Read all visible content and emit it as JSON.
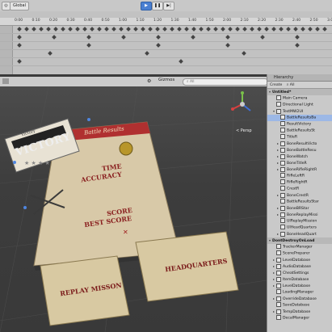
{
  "toolbar": {
    "pivot_label": "Global",
    "play_icon": "play-icon",
    "pause_icon": "pause-icon",
    "step_icon": "step-icon"
  },
  "timeline": {
    "ticks": [
      "0:00",
      "0:10",
      "0:20",
      "0:30",
      "0:40",
      "0:50",
      "1:00",
      "1:10",
      "1:20",
      "1:30",
      "1:40",
      "1:50",
      "2:00",
      "2:10",
      "2:20",
      "2:30",
      "2:40",
      "2:50",
      "3:00"
    ]
  },
  "scene_view": {
    "gizmos_label": "Gizmos",
    "search_placeholder": "All",
    "persp_label": "< Persp"
  },
  "game_ui": {
    "victory_banner_top": "Victory",
    "victory_banner": "VICTORY",
    "panel_header": "Battle Results",
    "time_label": "TIME",
    "accuracy_label": "ACCURACY",
    "score_label": "SCORE",
    "best_score_label": "BEST SCORE",
    "replay_button": "REPLAY MISSON",
    "hq_button": "HEADQUARTERS"
  },
  "hierarchy": {
    "tab_label": "Hierarchy",
    "create_label": "Create",
    "search_placeholder": "All",
    "scene_name": "Untitled*",
    "items": [
      {
        "label": "Main Camera",
        "indent": 1,
        "arrow": ""
      },
      {
        "label": "Directional Light",
        "indent": 1,
        "arrow": ""
      },
      {
        "label": "TestMW2UI",
        "indent": 1,
        "arrow": "▾"
      },
      {
        "label": "BattleResultsBa",
        "indent": 2,
        "arrow": "",
        "selected": true
      },
      {
        "label": "ResultVictory",
        "indent": 2,
        "arrow": ""
      },
      {
        "label": "BattleResultsSt",
        "indent": 2,
        "arrow": ""
      },
      {
        "label": "TitleR",
        "indent": 2,
        "arrow": ""
      },
      {
        "label": "BoneResultVicto",
        "indent": 2,
        "arrow": "▸"
      },
      {
        "label": "BoneBattleResu",
        "indent": 2,
        "arrow": "▸"
      },
      {
        "label": "BoneWatch",
        "indent": 2,
        "arrow": "▸"
      },
      {
        "label": "BoneTitleR",
        "indent": 2,
        "arrow": "▸"
      },
      {
        "label": "BoneRifleRightR",
        "indent": 2,
        "arrow": "▸"
      },
      {
        "label": "RifleLeftR",
        "indent": 2,
        "arrow": ""
      },
      {
        "label": "RifleRightR",
        "indent": 2,
        "arrow": ""
      },
      {
        "label": "CrestR",
        "indent": 2,
        "arrow": ""
      },
      {
        "label": "BoneCrestR",
        "indent": 2,
        "arrow": "▸"
      },
      {
        "label": "BattleResultsStar",
        "indent": 2,
        "arrow": ""
      },
      {
        "label": "BoneBRStar",
        "indent": 2,
        "arrow": "▸"
      },
      {
        "label": "BoneReplayMissi",
        "indent": 2,
        "arrow": "▸"
      },
      {
        "label": "UIReplayMission",
        "indent": 2,
        "arrow": ""
      },
      {
        "label": "UIHeadQuarters",
        "indent": 2,
        "arrow": ""
      },
      {
        "label": "BoneHeadQuart",
        "indent": 2,
        "arrow": "▸"
      }
    ],
    "scene2_name": "DontDestroyOnLoad",
    "items2": [
      {
        "label": "TrackerManager",
        "indent": 1,
        "arrow": ""
      },
      {
        "label": "ScenePreparer",
        "indent": 1,
        "arrow": ""
      },
      {
        "label": "LevelDatabase",
        "indent": 1,
        "arrow": "▸"
      },
      {
        "label": "AudioDatabase",
        "indent": 1,
        "arrow": "▸"
      },
      {
        "label": "CheatSettings",
        "indent": 1,
        "arrow": "▸"
      },
      {
        "label": "ItemDatabase",
        "indent": 1,
        "arrow": "▸"
      },
      {
        "label": "LevelDatabase",
        "indent": 1,
        "arrow": "▸"
      },
      {
        "label": "LoadingManager",
        "indent": 1,
        "arrow": ""
      },
      {
        "label": "OverrideDatabase",
        "indent": 1,
        "arrow": "▸"
      },
      {
        "label": "SaveDatabase",
        "indent": 1,
        "arrow": ""
      },
      {
        "label": "TempDatabase",
        "indent": 1,
        "arrow": "▸"
      },
      {
        "label": "DecalManager",
        "indent": 1,
        "arrow": ""
      }
    ]
  }
}
